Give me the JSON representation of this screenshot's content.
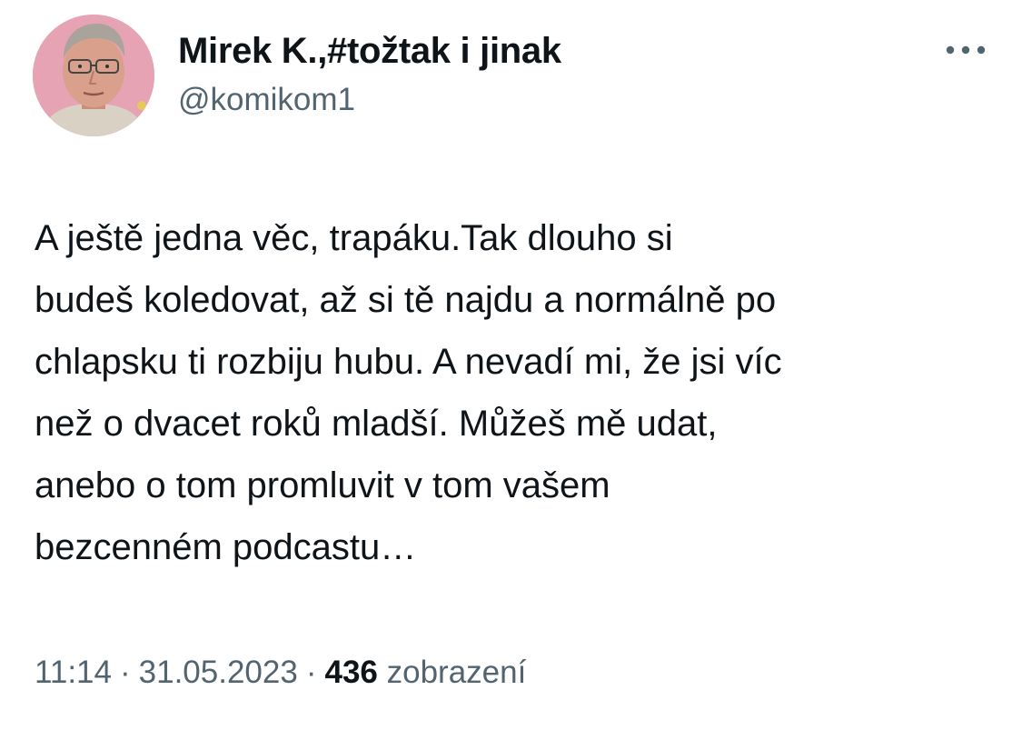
{
  "author": {
    "display_name": "Mirek K.,#tožtak i jinak",
    "handle": "@komikom1"
  },
  "menu": {
    "icon": "more-horizontal-icon"
  },
  "tweet": {
    "text": "A ještě jedna věc, trapáku.Tak dlouho si\nbudeš koledovat, až si tě najdu a normálně po\nchlapsku ti rozbiju hubu. A nevadí mi, že jsi víc\nnež o dvacet roků mladší. Můžeš mě udat,\nanebo o tom promluvit v tom vašem\nbezcenném podcastu…"
  },
  "meta": {
    "time": "11:14",
    "separator": "·",
    "date": "31.05.2023",
    "views_count": "436",
    "views_label": "zobrazení"
  },
  "colors": {
    "text_primary": "#0f1419",
    "text_secondary": "#536471",
    "avatar_background": "#e8a6b6"
  }
}
